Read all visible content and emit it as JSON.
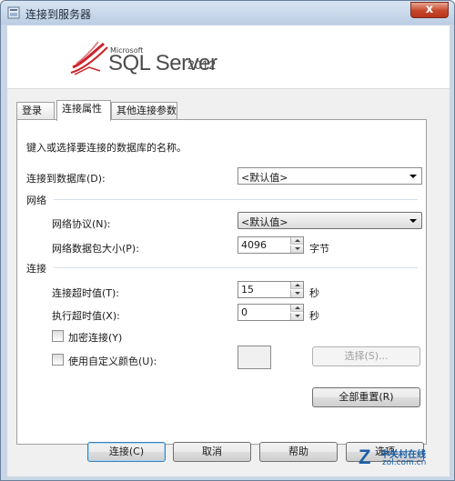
{
  "window": {
    "title": "连接到服务器",
    "close_glyph": "x"
  },
  "banner": {
    "brand_microsoft": "Microsoft",
    "product": "SQL Server",
    "version": "2012"
  },
  "tabs": [
    {
      "label": "登录",
      "active": false
    },
    {
      "label": "连接属性",
      "active": true
    },
    {
      "label": "其他连接参数",
      "active": false
    }
  ],
  "panel": {
    "instruction": "键入或选择要连接的数据库的名称。",
    "database_label": "连接到数据库(D):",
    "database_value": "<默认值>",
    "network_section": "网络",
    "protocol_label": "网络协议(N):",
    "protocol_value": "<默认值>",
    "packet_label": "网络数据包大小(P):",
    "packet_value": "4096",
    "packet_unit": "字节",
    "connection_section": "连接",
    "conn_timeout_label": "连接超时值(T):",
    "conn_timeout_value": "15",
    "conn_timeout_unit": "秒",
    "exec_timeout_label": "执行超时值(X):",
    "exec_timeout_value": "0",
    "exec_timeout_unit": "秒",
    "encrypt_label": "加密连接(Y)",
    "encrypt_checked": false,
    "custom_color_label": "使用自定义颜色(U):",
    "custom_color_checked": false,
    "select_button": "选择(S)...",
    "reset_all_button": "全部重置(R)"
  },
  "footer": {
    "connect": "连接(C)",
    "cancel": "取消",
    "help": "帮助",
    "options_partial": "选项"
  },
  "watermark": {
    "text": "中关村在线",
    "url": "zol.com.cn"
  },
  "colors": {
    "accent": "#3c7fb1",
    "close": "#c7472b",
    "logo_red": "#cc2229"
  },
  "icons": [
    "app-icon",
    "sql-server-logo-icon",
    "dropdown-arrow-icon",
    "spin-up-icon",
    "spin-down-icon"
  ]
}
